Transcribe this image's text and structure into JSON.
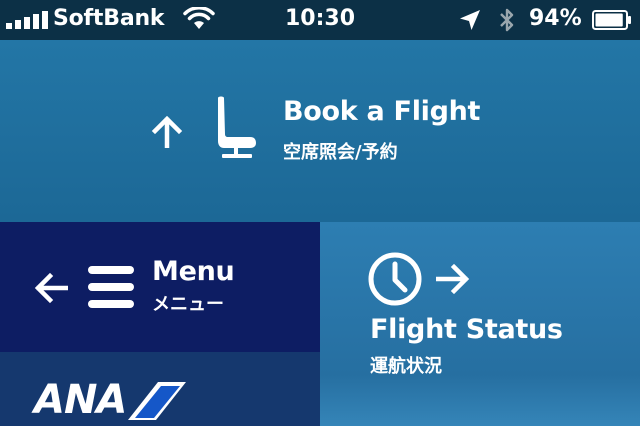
{
  "status_bar": {
    "carrier": "SoftBank",
    "time": "10:30",
    "battery_percent": "94%",
    "battery_level": 0.94
  },
  "tiles": {
    "book": {
      "label_en": "Book a Flight",
      "label_ja": "空席照会/予約",
      "icon": "seat-icon"
    },
    "menu": {
      "label_en": "Menu",
      "label_ja": "メニュー",
      "icon": "hamburger-icon"
    },
    "status": {
      "label_en": "Flight Status",
      "label_ja": "運航状況",
      "icon": "clock-icon"
    }
  },
  "brand": {
    "logo_text": "ANA"
  },
  "colors": {
    "status_bar": "#0c3046",
    "book_tile": "#2376a6",
    "menu_tile": "#0d1d63",
    "status_tile": "#2d7eb2",
    "logo_tile": "#15386e"
  }
}
